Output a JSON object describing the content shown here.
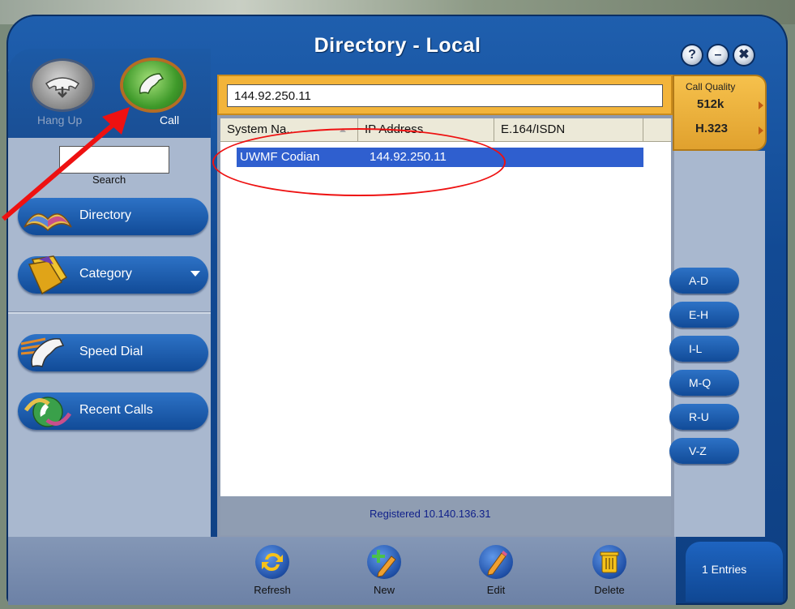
{
  "window": {
    "title": "Directory - Local"
  },
  "window_controls": {
    "help": "?",
    "minimize": "–",
    "close": "✖"
  },
  "left": {
    "hang_up_label": "Hang Up",
    "call_label": "Call",
    "search_label": "Search",
    "search_value": "",
    "nav": [
      {
        "label": "Directory"
      },
      {
        "label": "Category"
      },
      {
        "label": "Speed Dial"
      },
      {
        "label": "Recent Calls"
      }
    ]
  },
  "address": {
    "value": "144.92.250.11"
  },
  "table": {
    "columns": [
      "System Na...",
      "IP Address",
      "E.164/ISDN"
    ],
    "rows": [
      {
        "system_name": "UWMF Codian",
        "ip": "144.92.250.11",
        "e164": ""
      }
    ]
  },
  "status": {
    "text": "Registered 10.140.136.31"
  },
  "call_quality": {
    "title": "Call Quality",
    "rate": "512k",
    "protocol": "H.323"
  },
  "alpha_filters": [
    "A-D",
    "E-H",
    "I-L",
    "M-Q",
    "R-U",
    "V-Z"
  ],
  "toolbar": {
    "refresh": "Refresh",
    "new": "New",
    "edit": "Edit",
    "delete": "Delete"
  },
  "entries": {
    "text": "1 Entries"
  },
  "colors": {
    "frame": "#124a94",
    "accent": "#f3b43a",
    "selection": "#2f5fcf",
    "annotation": "#e11111"
  }
}
